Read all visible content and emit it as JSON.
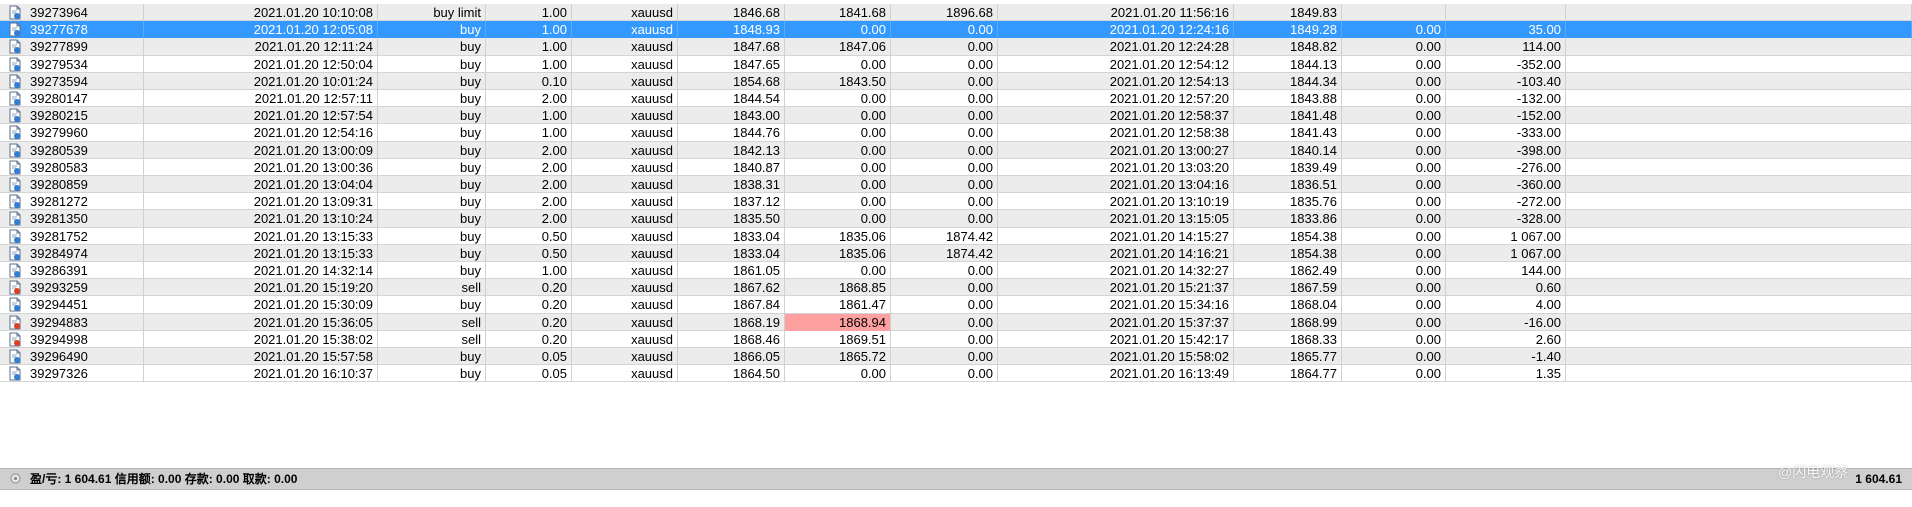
{
  "orders": [
    {
      "ticket": "39273964",
      "open_time": "2021.01.20 10:10:08",
      "type": "buy limit",
      "size": "1.00",
      "symbol": "xauusd",
      "open_price": "1846.68",
      "sl": "1841.68",
      "tp": "1896.68",
      "close_time": "2021.01.20 11:56:16",
      "close_price": "1849.83",
      "commission": "",
      "profit": "",
      "icon": "buy"
    },
    {
      "ticket": "39277678",
      "open_time": "2021.01.20 12:05:08",
      "type": "buy",
      "size": "1.00",
      "symbol": "xauusd",
      "open_price": "1848.93",
      "sl": "0.00",
      "tp": "0.00",
      "close_time": "2021.01.20 12:24:16",
      "close_price": "1849.28",
      "commission": "0.00",
      "profit": "35.00",
      "icon": "buy"
    },
    {
      "ticket": "39277899",
      "open_time": "2021.01.20 12:11:24",
      "type": "buy",
      "size": "1.00",
      "symbol": "xauusd",
      "open_price": "1847.68",
      "sl": "1847.06",
      "tp": "0.00",
      "close_time": "2021.01.20 12:24:28",
      "close_price": "1848.82",
      "commission": "0.00",
      "profit": "114.00",
      "icon": "buy"
    },
    {
      "ticket": "39279534",
      "open_time": "2021.01.20 12:50:04",
      "type": "buy",
      "size": "1.00",
      "symbol": "xauusd",
      "open_price": "1847.65",
      "sl": "0.00",
      "tp": "0.00",
      "close_time": "2021.01.20 12:54:12",
      "close_price": "1844.13",
      "commission": "0.00",
      "profit": "-352.00",
      "icon": "buy"
    },
    {
      "ticket": "39273594",
      "open_time": "2021.01.20 10:01:24",
      "type": "buy",
      "size": "0.10",
      "symbol": "xauusd",
      "open_price": "1854.68",
      "sl": "1843.50",
      "tp": "0.00",
      "close_time": "2021.01.20 12:54:13",
      "close_price": "1844.34",
      "commission": "0.00",
      "profit": "-103.40",
      "icon": "buy"
    },
    {
      "ticket": "39280147",
      "open_time": "2021.01.20 12:57:11",
      "type": "buy",
      "size": "2.00",
      "symbol": "xauusd",
      "open_price": "1844.54",
      "sl": "0.00",
      "tp": "0.00",
      "close_time": "2021.01.20 12:57:20",
      "close_price": "1843.88",
      "commission": "0.00",
      "profit": "-132.00",
      "icon": "buy"
    },
    {
      "ticket": "39280215",
      "open_time": "2021.01.20 12:57:54",
      "type": "buy",
      "size": "1.00",
      "symbol": "xauusd",
      "open_price": "1843.00",
      "sl": "0.00",
      "tp": "0.00",
      "close_time": "2021.01.20 12:58:37",
      "close_price": "1841.48",
      "commission": "0.00",
      "profit": "-152.00",
      "icon": "buy"
    },
    {
      "ticket": "39279960",
      "open_time": "2021.01.20 12:54:16",
      "type": "buy",
      "size": "1.00",
      "symbol": "xauusd",
      "open_price": "1844.76",
      "sl": "0.00",
      "tp": "0.00",
      "close_time": "2021.01.20 12:58:38",
      "close_price": "1841.43",
      "commission": "0.00",
      "profit": "-333.00",
      "icon": "buy"
    },
    {
      "ticket": "39280539",
      "open_time": "2021.01.20 13:00:09",
      "type": "buy",
      "size": "2.00",
      "symbol": "xauusd",
      "open_price": "1842.13",
      "sl": "0.00",
      "tp": "0.00",
      "close_time": "2021.01.20 13:00:27",
      "close_price": "1840.14",
      "commission": "0.00",
      "profit": "-398.00",
      "icon": "buy"
    },
    {
      "ticket": "39280583",
      "open_time": "2021.01.20 13:00:36",
      "type": "buy",
      "size": "2.00",
      "symbol": "xauusd",
      "open_price": "1840.87",
      "sl": "0.00",
      "tp": "0.00",
      "close_time": "2021.01.20 13:03:20",
      "close_price": "1839.49",
      "commission": "0.00",
      "profit": "-276.00",
      "icon": "buy"
    },
    {
      "ticket": "39280859",
      "open_time": "2021.01.20 13:04:04",
      "type": "buy",
      "size": "2.00",
      "symbol": "xauusd",
      "open_price": "1838.31",
      "sl": "0.00",
      "tp": "0.00",
      "close_time": "2021.01.20 13:04:16",
      "close_price": "1836.51",
      "commission": "0.00",
      "profit": "-360.00",
      "icon": "buy"
    },
    {
      "ticket": "39281272",
      "open_time": "2021.01.20 13:09:31",
      "type": "buy",
      "size": "2.00",
      "symbol": "xauusd",
      "open_price": "1837.12",
      "sl": "0.00",
      "tp": "0.00",
      "close_time": "2021.01.20 13:10:19",
      "close_price": "1835.76",
      "commission": "0.00",
      "profit": "-272.00",
      "icon": "buy"
    },
    {
      "ticket": "39281350",
      "open_time": "2021.01.20 13:10:24",
      "type": "buy",
      "size": "2.00",
      "symbol": "xauusd",
      "open_price": "1835.50",
      "sl": "0.00",
      "tp": "0.00",
      "close_time": "2021.01.20 13:15:05",
      "close_price": "1833.86",
      "commission": "0.00",
      "profit": "-328.00",
      "icon": "buy"
    },
    {
      "ticket": "39281752",
      "open_time": "2021.01.20 13:15:33",
      "type": "buy",
      "size": "0.50",
      "symbol": "xauusd",
      "open_price": "1833.04",
      "sl": "1835.06",
      "tp": "1874.42",
      "close_time": "2021.01.20 14:15:27",
      "close_price": "1854.38",
      "commission": "0.00",
      "profit": "1 067.00",
      "icon": "buy"
    },
    {
      "ticket": "39284974",
      "open_time": "2021.01.20 13:15:33",
      "type": "buy",
      "size": "0.50",
      "symbol": "xauusd",
      "open_price": "1833.04",
      "sl": "1835.06",
      "tp": "1874.42",
      "close_time": "2021.01.20 14:16:21",
      "close_price": "1854.38",
      "commission": "0.00",
      "profit": "1 067.00",
      "icon": "buy"
    },
    {
      "ticket": "39286391",
      "open_time": "2021.01.20 14:32:14",
      "type": "buy",
      "size": "1.00",
      "symbol": "xauusd",
      "open_price": "1861.05",
      "sl": "0.00",
      "tp": "0.00",
      "close_time": "2021.01.20 14:32:27",
      "close_price": "1862.49",
      "commission": "0.00",
      "profit": "144.00",
      "icon": "buy"
    },
    {
      "ticket": "39293259",
      "open_time": "2021.01.20 15:19:20",
      "type": "sell",
      "size": "0.20",
      "symbol": "xauusd",
      "open_price": "1867.62",
      "sl": "1868.85",
      "tp": "0.00",
      "close_time": "2021.01.20 15:21:37",
      "close_price": "1867.59",
      "commission": "0.00",
      "profit": "0.60",
      "icon": "sell"
    },
    {
      "ticket": "39294451",
      "open_time": "2021.01.20 15:30:09",
      "type": "buy",
      "size": "0.20",
      "symbol": "xauusd",
      "open_price": "1867.84",
      "sl": "1861.47",
      "tp": "0.00",
      "close_time": "2021.01.20 15:34:16",
      "close_price": "1868.04",
      "commission": "0.00",
      "profit": "4.00",
      "icon": "buy"
    },
    {
      "ticket": "39294883",
      "open_time": "2021.01.20 15:36:05",
      "type": "sell",
      "size": "0.20",
      "symbol": "xauusd",
      "open_price": "1868.19",
      "sl": "1868.94",
      "tp": "0.00",
      "close_time": "2021.01.20 15:37:37",
      "close_price": "1868.99",
      "commission": "0.00",
      "profit": "-16.00",
      "icon": "sell"
    },
    {
      "ticket": "39294998",
      "open_time": "2021.01.20 15:38:02",
      "type": "sell",
      "size": "0.20",
      "symbol": "xauusd",
      "open_price": "1868.46",
      "sl": "1869.51",
      "tp": "0.00",
      "close_time": "2021.01.20 15:42:17",
      "close_price": "1868.33",
      "commission": "0.00",
      "profit": "2.60",
      "icon": "sell"
    },
    {
      "ticket": "39296490",
      "open_time": "2021.01.20 15:57:58",
      "type": "buy",
      "size": "0.05",
      "symbol": "xauusd",
      "open_price": "1866.05",
      "sl": "1865.72",
      "tp": "0.00",
      "close_time": "2021.01.20 15:58:02",
      "close_price": "1865.77",
      "commission": "0.00",
      "profit": "-1.40",
      "icon": "buy"
    },
    {
      "ticket": "39297326",
      "open_time": "2021.01.20 16:10:37",
      "type": "buy",
      "size": "0.05",
      "symbol": "xauusd",
      "open_price": "1864.50",
      "sl": "0.00",
      "tp": "0.00",
      "close_time": "2021.01.20 16:13:49",
      "close_price": "1864.77",
      "commission": "0.00",
      "profit": "1.35",
      "icon": "buy"
    }
  ],
  "selected_ticket": "39277678",
  "highlighted_sl_ticket": "39294883",
  "footer": {
    "summary": "盈/亏: 1 604.61  信用额: 0.00  存款: 0.00  取款: 0.00",
    "total": "1 604.61"
  },
  "watermark": "@闪电观察",
  "colors": {
    "selected_row": "#3399ff",
    "even_row": "#ececec",
    "highlight_cell": "#ffa0a0",
    "footer_bg": "#cfcfcf",
    "buy_icon": "#2f7fd8",
    "sell_icon": "#e04020"
  },
  "icons": {
    "buy": "document-buy-icon",
    "sell": "document-sell-icon"
  }
}
